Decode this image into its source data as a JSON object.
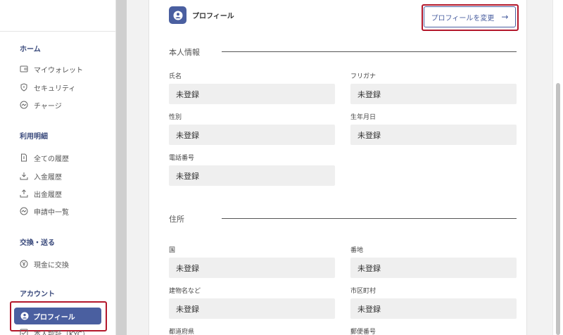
{
  "sidebar": {
    "sections": [
      {
        "title": "ホーム",
        "items": [
          {
            "label": "マイウォレット",
            "icon": "wallet-icon"
          },
          {
            "label": "セキュリティ",
            "icon": "shield-icon"
          },
          {
            "label": "チャージ",
            "icon": "charge-icon"
          }
        ]
      },
      {
        "title": "利用明細",
        "items": [
          {
            "label": "全ての履歴",
            "icon": "document-icon"
          },
          {
            "label": "入金履歴",
            "icon": "download-icon"
          },
          {
            "label": "出金履歴",
            "icon": "upload-icon"
          },
          {
            "label": "申請中一覧",
            "icon": "pending-icon"
          }
        ]
      },
      {
        "title": "交換・送る",
        "items": [
          {
            "label": "現金に交換",
            "icon": "yen-icon"
          }
        ]
      },
      {
        "title": "アカウント",
        "items": [
          {
            "label": "プロフィール",
            "icon": "user-circle-icon"
          },
          {
            "label": "本人認証（KYC）",
            "icon": "checkbox-icon"
          }
        ]
      }
    ],
    "active_item": "プロフィール"
  },
  "card": {
    "title": "プロフィール",
    "edit_button": "プロフィールを変更",
    "edit_arrow": "→"
  },
  "personal": {
    "heading": "本人情報",
    "fields": [
      {
        "label": "氏名",
        "value": "未登録"
      },
      {
        "label": "フリガナ",
        "value": "未登録"
      },
      {
        "label": "性別",
        "value": "未登録"
      },
      {
        "label": "生年月日",
        "value": "未登録"
      },
      {
        "label": "電話番号",
        "value": "未登録"
      }
    ]
  },
  "address": {
    "heading": "住所",
    "fields": [
      {
        "label": "国",
        "value": "未登録"
      },
      {
        "label": "番地",
        "value": "未登録"
      },
      {
        "label": "建物名など",
        "value": "未登録"
      },
      {
        "label": "市区町村",
        "value": "未登録"
      },
      {
        "label": "都道府県",
        "value": ""
      },
      {
        "label": "郵便番号",
        "value": ""
      }
    ]
  },
  "colors": {
    "accent": "#4a5fa0",
    "highlight": "#b3172b"
  }
}
